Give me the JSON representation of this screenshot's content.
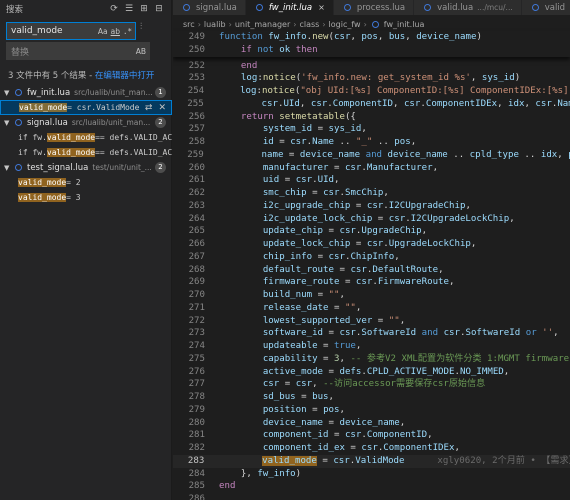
{
  "sidebar": {
    "title": "搜索",
    "search_value": "valid_mode",
    "opt_case": "Aa",
    "opt_word": "ab",
    "opt_regex": ".*",
    "replace_placeholder": "替换",
    "opt_preserve_case": "AB",
    "summary_text": "3 文件中有 5 个结果 - ",
    "summary_link": "在编辑器中打开",
    "files": [
      {
        "name": "fw_init.lua",
        "path": "src/lualib/unit_man...",
        "count": "1",
        "matches": [
          {
            "pre": "",
            "hit": "valid_mode",
            "post": " = csr.ValidMode"
          }
        ]
      },
      {
        "name": "signal.lua",
        "path": "src/lualib/unit_man...",
        "count": "2",
        "matches": [
          {
            "pre": "if fw.",
            "hit": "valid_mode",
            "post": " == defs.VALID_ACTI..."
          },
          {
            "pre": "if fw.",
            "hit": "valid_mode",
            "post": " == defs.VALID_ACTI..."
          }
        ]
      },
      {
        "name": "test_signal.lua",
        "path": "test/unit/unit_...",
        "count": "2",
        "matches": [
          {
            "pre": "",
            "hit": "valid_mode",
            "post": " = 2"
          },
          {
            "pre": "",
            "hit": "valid_mode",
            "post": " = 3"
          }
        ]
      }
    ]
  },
  "editor": {
    "tabs": [
      {
        "label": "signal.lua",
        "dim": ""
      },
      {
        "label": "fw_init.lua",
        "dim": "",
        "close": "×"
      },
      {
        "label": "process.lua",
        "dim": ""
      },
      {
        "label": "valid.lua",
        "dim": ".../mcu/..."
      },
      {
        "label": "valid",
        "dim": ""
      }
    ],
    "breadcrumb": [
      "src",
      "lualib",
      "unit_manager",
      "class",
      "logic_fw",
      "fw_init.lua"
    ],
    "sticky_lines": [
      {
        "num": "249",
        "html": "<span class='kb'>function</span> <span class='v'>fw_info</span>.<span class='f'>new</span>(<span class='v'>csr</span>, <span class='v'>pos</span>, <span class='v'>bus</span>, <span class='v'>device_name</span>)"
      },
      {
        "num": "250",
        "html": "    <span class='k'>if</span> <span class='kb'>not</span> <span class='v'>ok</span> <span class='k'>then</span>"
      }
    ],
    "lines": [
      {
        "num": "252",
        "html": "    <span class='k'>end</span>"
      },
      {
        "num": "253",
        "html": "    <span class='v'>log</span>:<span class='f'>notice</span>(<span class='s'>'fw_info.new: get_system_id %s'</span>, <span class='v'>sys_id</span>)"
      },
      {
        "num": "254",
        "html": "    <span class='v'>log</span>:<span class='f'>notice</span>(<span class='s'>\"obj UId:[%s] ComponentID:[%s] ComponentIDEx:[%s]\"</span>,"
      },
      {
        "num": "255",
        "html": "        <span class='v'>csr</span>.<span class='v'>UId</span>, <span class='v'>csr</span>.<span class='v'>ComponentID</span>, <span class='v'>csr</span>.<span class='v'>ComponentIDEx</span>, <span class='v'>idx</span>, <span class='v'>csr</span>.<span class='v'>Name</span>)"
      },
      {
        "num": "256",
        "html": "    <span class='k'>return</span> <span class='f'>setmetatable</span>({"
      },
      {
        "num": "257",
        "html": "        <span class='v'>system_id</span> = <span class='v'>sys_id</span>,"
      },
      {
        "num": "258",
        "html": "        <span class='v'>id</span> = <span class='v'>csr</span>.<span class='v'>Name</span> .. <span class='s'>\"_\"</span> .. <span class='v'>pos</span>,"
      },
      {
        "num": "259",
        "html": "        <span class='v'>name</span> = <span class='v'>device_name</span> <span class='kb'>and</span> <span class='v'>device_name</span> .. <span class='v'>cpld_type</span> .. <span class='v'>idx</span>, <span class='v'>pos</span>"
      },
      {
        "num": "260",
        "html": "        <span class='v'>manufacturer</span> = <span class='v'>csr</span>.<span class='v'>Manufacturer</span>,"
      },
      {
        "num": "261",
        "html": "        <span class='v'>uid</span> = <span class='v'>csr</span>.<span class='v'>UId</span>,"
      },
      {
        "num": "262",
        "html": "        <span class='v'>smc_chip</span> = <span class='v'>csr</span>.<span class='v'>SmcChip</span>,"
      },
      {
        "num": "263",
        "html": "        <span class='v'>i2c_upgrade_chip</span> = <span class='v'>csr</span>.<span class='v'>I2CUpgradeChip</span>,"
      },
      {
        "num": "264",
        "html": "        <span class='v'>i2c_update_lock_chip</span> = <span class='v'>csr</span>.<span class='v'>I2CUpgradeLockChip</span>,"
      },
      {
        "num": "265",
        "html": "        <span class='v'>update_chip</span> = <span class='v'>csr</span>.<span class='v'>UpgradeChip</span>,"
      },
      {
        "num": "266",
        "html": "        <span class='v'>update_lock_chip</span> = <span class='v'>csr</span>.<span class='v'>UpgradeLockChip</span>,"
      },
      {
        "num": "267",
        "html": "        <span class='v'>chip_info</span> = <span class='v'>csr</span>.<span class='v'>ChipInfo</span>,"
      },
      {
        "num": "268",
        "html": "        <span class='v'>default_route</span> = <span class='v'>csr</span>.<span class='v'>DefaultRoute</span>,"
      },
      {
        "num": "269",
        "html": "        <span class='v'>firmware_route</span> = <span class='v'>csr</span>.<span class='v'>FirmwareRoute</span>,"
      },
      {
        "num": "270",
        "html": "        <span class='v'>build_num</span> = <span class='s'>\"\"</span>,"
      },
      {
        "num": "271",
        "html": "        <span class='v'>release_date</span> = <span class='s'>\"\"</span>,"
      },
      {
        "num": "272",
        "html": "        <span class='v'>lowest_supported_ver</span> = <span class='s'>\"\"</span>,"
      },
      {
        "num": "273",
        "html": "        <span class='v'>software_id</span> = <span class='v'>csr</span>.<span class='v'>SoftwareId</span> <span class='kb'>and</span> <span class='v'>csr</span>.<span class='v'>SoftwareId</span> <span class='kb'>or</span> <span class='s'>''</span>,"
      },
      {
        "num": "274",
        "html": "        <span class='v'>updateable</span> = <span class='kb'>true</span>,"
      },
      {
        "num": "275",
        "html": "        <span class='v'>capability</span> = <span class='n'>3</span>, <span class='c'>-- 参考V2 XML配置为软件分类 1:MGMT firmware</span>"
      },
      {
        "num": "276",
        "html": "        <span class='v'>active_mode</span> = <span class='v'>defs</span>.<span class='v'>CPLD_ACTIVE_MODE</span>.<span class='v'>NO_IMMED</span>,"
      },
      {
        "num": "277",
        "html": "        <span class='v'>csr</span> = <span class='v'>csr</span>, <span class='c'>--访问accessor需要保存csr原始信息</span>"
      },
      {
        "num": "278",
        "html": "        <span class='v'>sd_bus</span> = <span class='v'>bus</span>,"
      },
      {
        "num": "279",
        "html": "        <span class='v'>position</span> = <span class='v'>pos</span>,"
      },
      {
        "num": "280",
        "html": "        <span class='v'>device_name</span> = <span class='v'>device_name</span>,"
      },
      {
        "num": "281",
        "html": "        <span class='v'>component_id</span> = <span class='v'>csr</span>.<span class='v'>ComponentID</span>,"
      },
      {
        "num": "282",
        "html": "        <span class='v'>component_id_ex</span> = <span class='v'>csr</span>.<span class='v'>ComponentIDEx</span>,"
      },
      {
        "num": "283",
        "current": true,
        "html": "        <span class='em'>valid_mode</span> = <span class='v'>csr</span>.<span class='v'>ValidMode</span>      <span class='blame'>xgly0620, 2个月前 • 【需求】</span>"
      },
      {
        "num": "284",
        "html": "    }, <span class='v'>fw_info</span>)"
      },
      {
        "num": "285",
        "html": "<span class='k'>end</span>"
      },
      {
        "num": "286",
        "html": ""
      }
    ]
  },
  "colors": {
    "accent": "#007fd4",
    "highlight": "#ea971a",
    "background": "#1e1e1e",
    "sidebar": "#252526"
  }
}
